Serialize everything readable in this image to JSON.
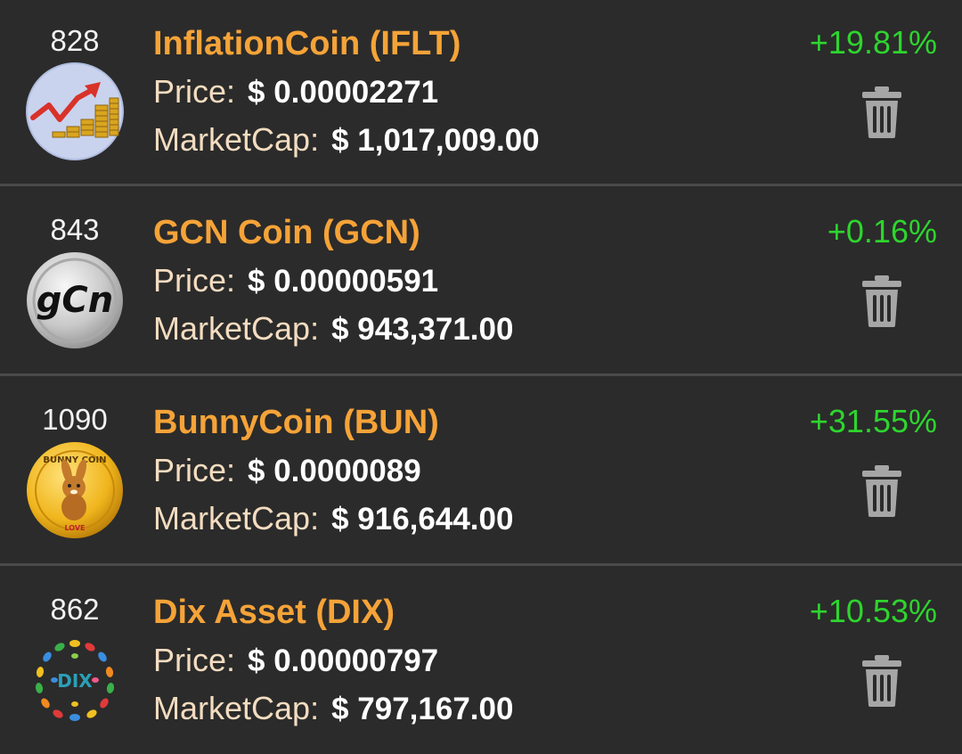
{
  "coins": [
    {
      "rank": "828",
      "name": "InflationCoin (IFLT)",
      "price_label": "Price:",
      "price": "$ 0.00002271",
      "mcap_label": "MarketCap:",
      "mcap": "$ 1,017,009.00",
      "change": "+19.81%",
      "logo": "inflationcoin-logo"
    },
    {
      "rank": "843",
      "name": "GCN Coin (GCN)",
      "price_label": "Price:",
      "price": "$ 0.00000591",
      "mcap_label": "MarketCap:",
      "mcap": "$ 943,371.00",
      "change": "+0.16%",
      "logo": "gcn-coin-logo"
    },
    {
      "rank": "1090",
      "name": "BunnyCoin (BUN)",
      "price_label": "Price:",
      "price": "$ 0.0000089",
      "mcap_label": "MarketCap:",
      "mcap": "$ 916,644.00",
      "change": "+31.55%",
      "logo": "bunnycoin-logo"
    },
    {
      "rank": "862",
      "name": "Dix Asset (DIX)",
      "price_label": "Price:",
      "price": "$ 0.00000797",
      "mcap_label": "MarketCap:",
      "mcap": "$ 797,167.00",
      "change": "+10.53%",
      "logo": "dix-asset-logo"
    }
  ],
  "logo_text": {
    "gcn": "gCn",
    "bunny_top": "BUNNY COIN",
    "bunny_bottom": "LOVE",
    "dix": "DIX"
  },
  "colors": {
    "background": "#2b2b2b",
    "divider": "#4a4a4a",
    "name": "#f5a338",
    "label": "#f3dcc0",
    "value": "#ffffff",
    "positive": "#2ed52e",
    "trash": "#a6a6a6"
  },
  "icons": {
    "delete": "trash-icon"
  }
}
